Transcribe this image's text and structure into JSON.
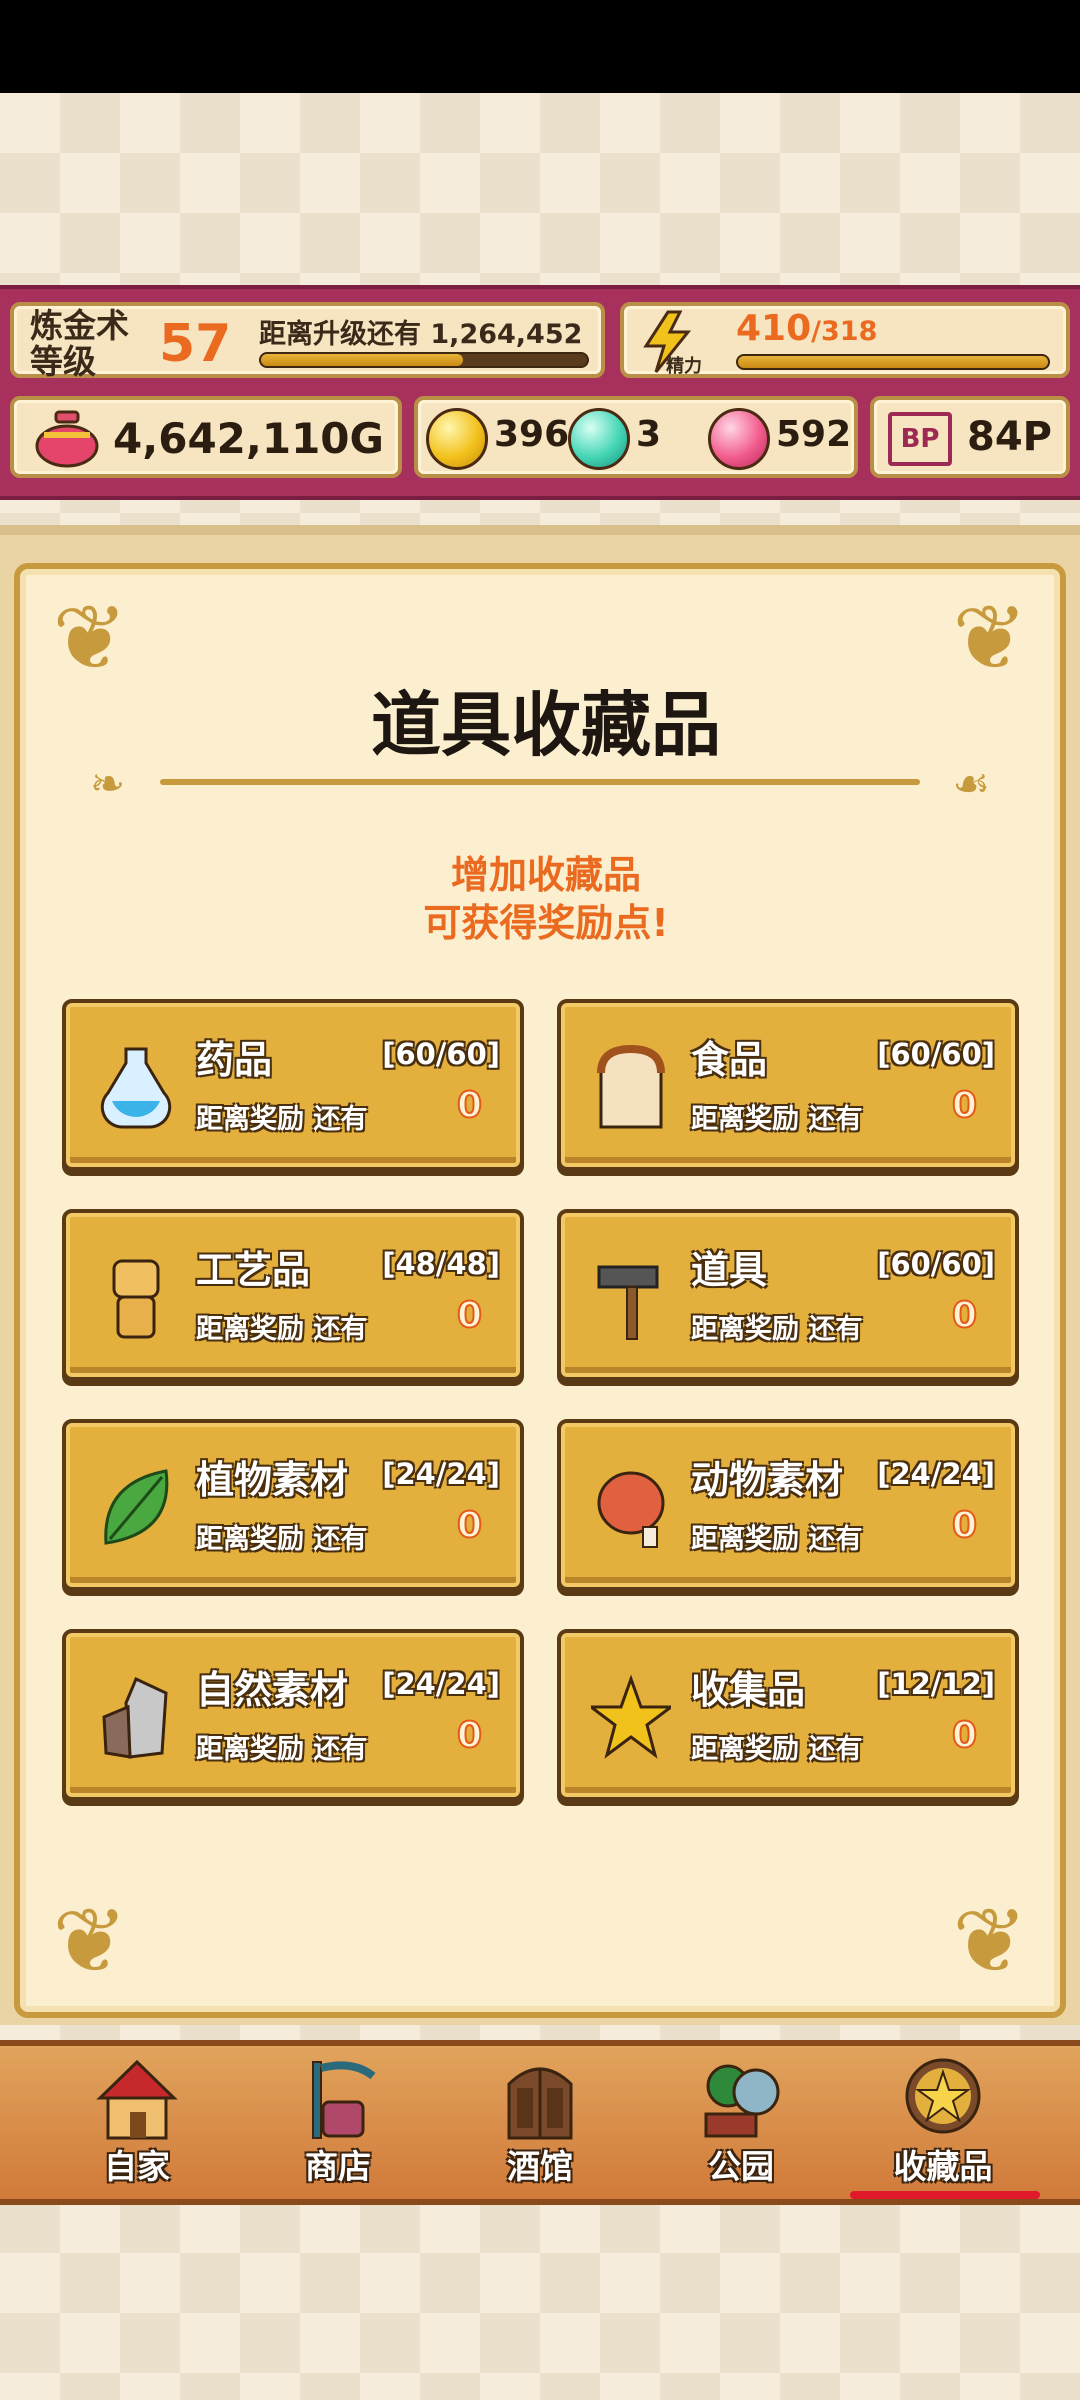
{
  "hud": {
    "level_label": "炼金术\n等级",
    "level_value": "57",
    "next_level_text": "距离升级还有 1,264,452",
    "level_progress": 0.62,
    "energy_label": "精力",
    "energy_value": "410",
    "energy_max": "/318",
    "energy_progress": 1.0,
    "gold_value": "4,642,110G",
    "gem_yellow": "396",
    "gem_cyan": "3",
    "gem_pink": "592",
    "bp_icon_text": "BP",
    "bp_value": "84P"
  },
  "main": {
    "title": "道具收藏品",
    "subtitle_line1": "增加收藏品",
    "subtitle_line2": "可获得奖励点!",
    "categories": [
      {
        "name": "药品",
        "count": "[60/60]",
        "desc": "距离奖励 还有",
        "remaining": "0",
        "icon": "potion-icon"
      },
      {
        "name": "食品",
        "count": "[60/60]",
        "desc": "距离奖励 还有",
        "remaining": "0",
        "icon": "bread-icon"
      },
      {
        "name": "工艺品",
        "count": "[48/48]",
        "desc": "距离奖励 还有",
        "remaining": "0",
        "icon": "craft-doll-icon"
      },
      {
        "name": "道具",
        "count": "[60/60]",
        "desc": "距离奖励 还有",
        "remaining": "0",
        "icon": "hammer-icon"
      },
      {
        "name": "植物素材",
        "count": "[24/24]",
        "desc": "距离奖励 还有",
        "remaining": "0",
        "icon": "leaf-icon"
      },
      {
        "name": "动物素材",
        "count": "[24/24]",
        "desc": "距离奖励 还有",
        "remaining": "0",
        "icon": "meat-icon"
      },
      {
        "name": "自然素材",
        "count": "[24/24]",
        "desc": "距离奖励 还有",
        "remaining": "0",
        "icon": "stone-icon"
      },
      {
        "name": "收集品",
        "count": "[12/12]",
        "desc": "距离奖励 还有",
        "remaining": "0",
        "icon": "star-icon"
      }
    ]
  },
  "nav": {
    "items": [
      {
        "label": "自家",
        "icon": "house-icon"
      },
      {
        "label": "商店",
        "icon": "shop-icon"
      },
      {
        "label": "酒馆",
        "icon": "tavern-door-icon"
      },
      {
        "label": "公园",
        "icon": "park-icon"
      },
      {
        "label": "收藏品",
        "icon": "star-medal-icon"
      }
    ],
    "active": "收藏品"
  },
  "colors": {
    "accent_orange": "#ea6a1f",
    "hud_magenta": "#a8305c",
    "card_gold": "#e3b03e"
  }
}
